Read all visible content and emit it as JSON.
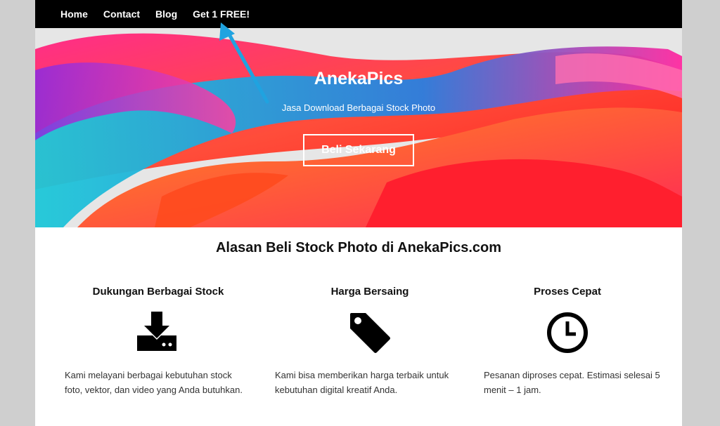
{
  "nav": {
    "items": [
      {
        "label": "Home"
      },
      {
        "label": "Contact"
      },
      {
        "label": "Blog"
      },
      {
        "label": "Get 1 FREE!"
      }
    ]
  },
  "hero": {
    "title": "AnekaPics",
    "subtitle": "Jasa Download Berbagai Stock Photo",
    "button_label": "Beli Sekarang"
  },
  "reasons": {
    "title": "Alasan Beli Stock Photo di AnekaPics.com",
    "features": [
      {
        "title": "Dukungan Berbagai Stock",
        "icon": "download-drive-icon",
        "description": "Kami melayani berbagai kebutuhan stock foto, vektor, dan video yang Anda butuhkan."
      },
      {
        "title": "Harga Bersaing",
        "icon": "price-tag-icon",
        "description": "Kami bisa memberikan harga terbaik untuk kebutuhan digital kreatif Anda."
      },
      {
        "title": "Proses Cepat",
        "icon": "clock-icon",
        "description": "Pesanan diproses cepat. Estimasi selesai 5 menit – 1 jam."
      }
    ]
  },
  "colors": {
    "navbar": "#000000",
    "annotation_arrow": "#1fa3e0",
    "page_background": "#cfcfcf"
  }
}
